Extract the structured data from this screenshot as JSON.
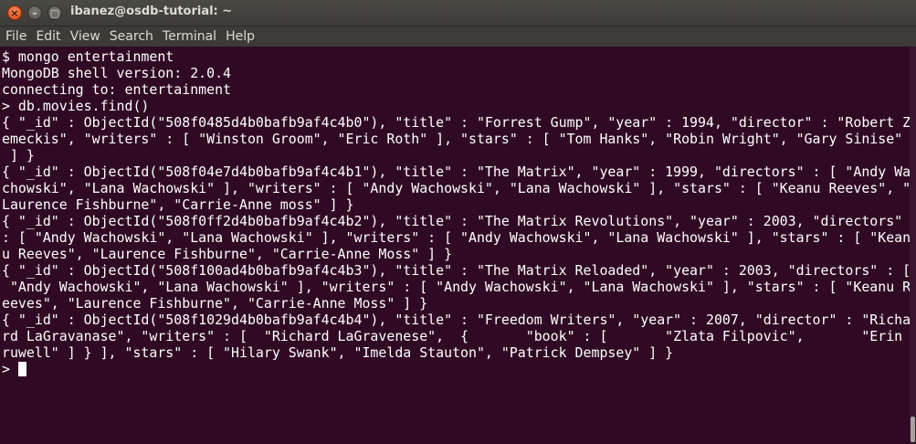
{
  "window": {
    "title": "ibanez@osdb-tutorial: ~",
    "close_glyph": "×",
    "minimize_glyph": "–",
    "maximize_glyph": "□"
  },
  "menubar": {
    "items": [
      "File",
      "Edit",
      "View",
      "Search",
      "Terminal",
      "Help"
    ]
  },
  "terminal": {
    "lines": [
      "$ mongo entertainment",
      "MongoDB shell version: 2.0.4",
      "connecting to: entertainment",
      "> db.movies.find()",
      "{ \"_id\" : ObjectId(\"508f0485d4b0bafb9af4c4b0\"), \"title\" : \"Forrest Gump\", \"year\" : 1994, \"director\" : \"Robert Z",
      "emeckis\", \"writers\" : [ \"Winston Groom\", \"Eric Roth\" ], \"stars\" : [ \"Tom Hanks\", \"Robin Wright\", \"Gary Sinise\"",
      " ] }",
      "{ \"_id\" : ObjectId(\"508f04e7d4b0bafb9af4c4b1\"), \"title\" : \"The Matrix\", \"year\" : 1999, \"directors\" : [ \"Andy Wa",
      "chowski\", \"Lana Wachowski\" ], \"writers\" : [ \"Andy Wachowski\", \"Lana Wachowski\" ], \"stars\" : [ \"Keanu Reeves\", \"",
      "Laurence Fishburne\", \"Carrie-Anne moss\" ] }",
      "{ \"_id\" : ObjectId(\"508f0ff2d4b0bafb9af4c4b2\"), \"title\" : \"The Matrix Revolutions\", \"year\" : 2003, \"directors\"",
      ": [ \"Andy Wachowski\", \"Lana Wachowski\" ], \"writers\" : [ \"Andy Wachowski\", \"Lana Wachowski\" ], \"stars\" : [ \"Kean",
      "u Reeves\", \"Laurence Fishburne\", \"Carrie-Anne Moss\" ] }",
      "{ \"_id\" : ObjectId(\"508f100ad4b0bafb9af4c4b3\"), \"title\" : \"The Matrix Reloaded\", \"year\" : 2003, \"directors\" : [",
      " \"Andy Wachowski\", \"Lana Wachowski\" ], \"writers\" : [ \"Andy Wachowski\", \"Lana Wachowski\" ], \"stars\" : [ \"Keanu R",
      "eeves\", \"Laurence Fishburne\", \"Carrie-Anne Moss\" ] }",
      "{ \"_id\" : ObjectId(\"508f1029d4b0bafb9af4c4b4\"), \"title\" : \"Freedom Writers\", \"year\" : 2007, \"director\" : \"Richa",
      "rd LaGravanase\", \"writers\" : [  \"Richard LaGravenese\",  {       \"book\" : [       \"Zlata Filpovic\",       \"Erin G",
      "ruwell\" ] } ], \"stars\" : [ \"Hilary Swank\", \"Imelda Stauton\", \"Patrick Dempsey\" ] }"
    ],
    "prompt": "> "
  }
}
